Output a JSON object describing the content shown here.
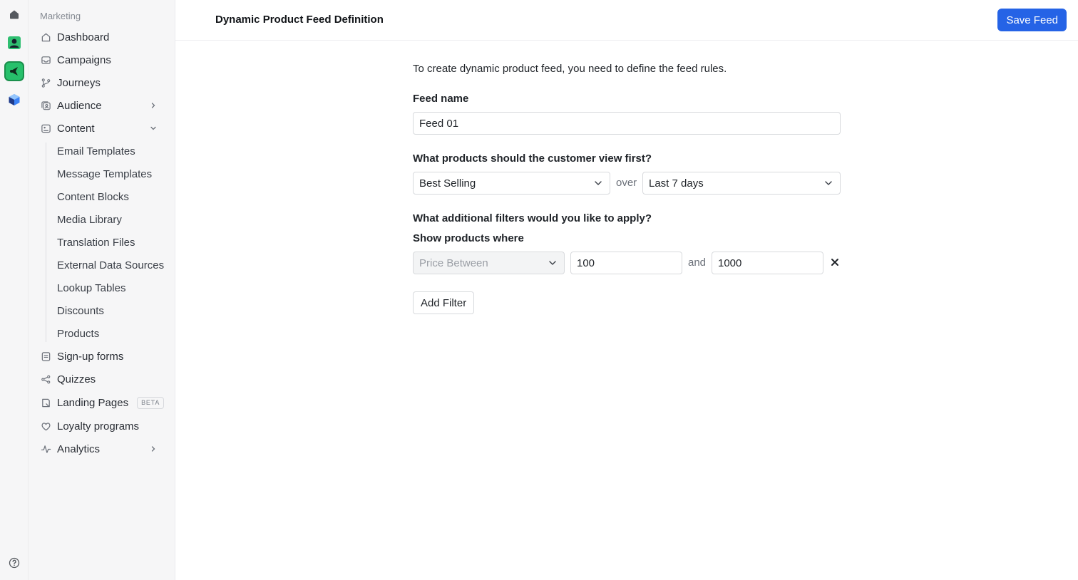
{
  "rail": {
    "icons": [
      "home-icon",
      "app-contact-icon",
      "app-marketing-icon",
      "app-cube-icon",
      "help-icon"
    ]
  },
  "sidebar": {
    "section": "Marketing",
    "items": [
      {
        "label": "Dashboard",
        "icon": "home-outline-icon"
      },
      {
        "label": "Campaigns",
        "icon": "inbox-icon"
      },
      {
        "label": "Journeys",
        "icon": "branch-icon"
      },
      {
        "label": "Audience",
        "icon": "audience-icon",
        "chevron": "right"
      },
      {
        "label": "Content",
        "icon": "content-icon",
        "chevron": "down"
      }
    ],
    "content_subitems": [
      "Email Templates",
      "Message Templates",
      "Content Blocks",
      "Media Library",
      "Translation Files",
      "External Data Sources",
      "Lookup Tables",
      "Discounts",
      "Products"
    ],
    "lower_items": [
      {
        "label": "Sign-up forms",
        "icon": "form-icon"
      },
      {
        "label": "Quizzes",
        "icon": "quiz-icon"
      },
      {
        "label": "Landing Pages",
        "icon": "landing-page-icon",
        "badge": "BETA"
      },
      {
        "label": "Loyalty programs",
        "icon": "heart-icon"
      },
      {
        "label": "Analytics",
        "icon": "activity-icon",
        "chevron": "right"
      }
    ]
  },
  "header": {
    "title": "Dynamic Product Feed Definition",
    "save_label": "Save Feed"
  },
  "form": {
    "intro": "To create dynamic product feed, you need to define the feed rules.",
    "feed_name_label": "Feed name",
    "feed_name_value": "Feed 01",
    "view_first_label": "What products should the customer view first?",
    "sort_value": "Best Selling",
    "over_word": "over",
    "period_value": "Last 7 days",
    "filters_label": "What additional filters would you like to apply?",
    "show_where_label": "Show products where",
    "filter": {
      "field_value": "Price Between",
      "min_value": "100",
      "and_word": "and",
      "max_value": "1000"
    },
    "add_filter_label": "Add Filter"
  },
  "colors": {
    "primary": "#2563e6",
    "app_green": "#27c06b",
    "sidebar_bg": "#f6f6f7"
  }
}
